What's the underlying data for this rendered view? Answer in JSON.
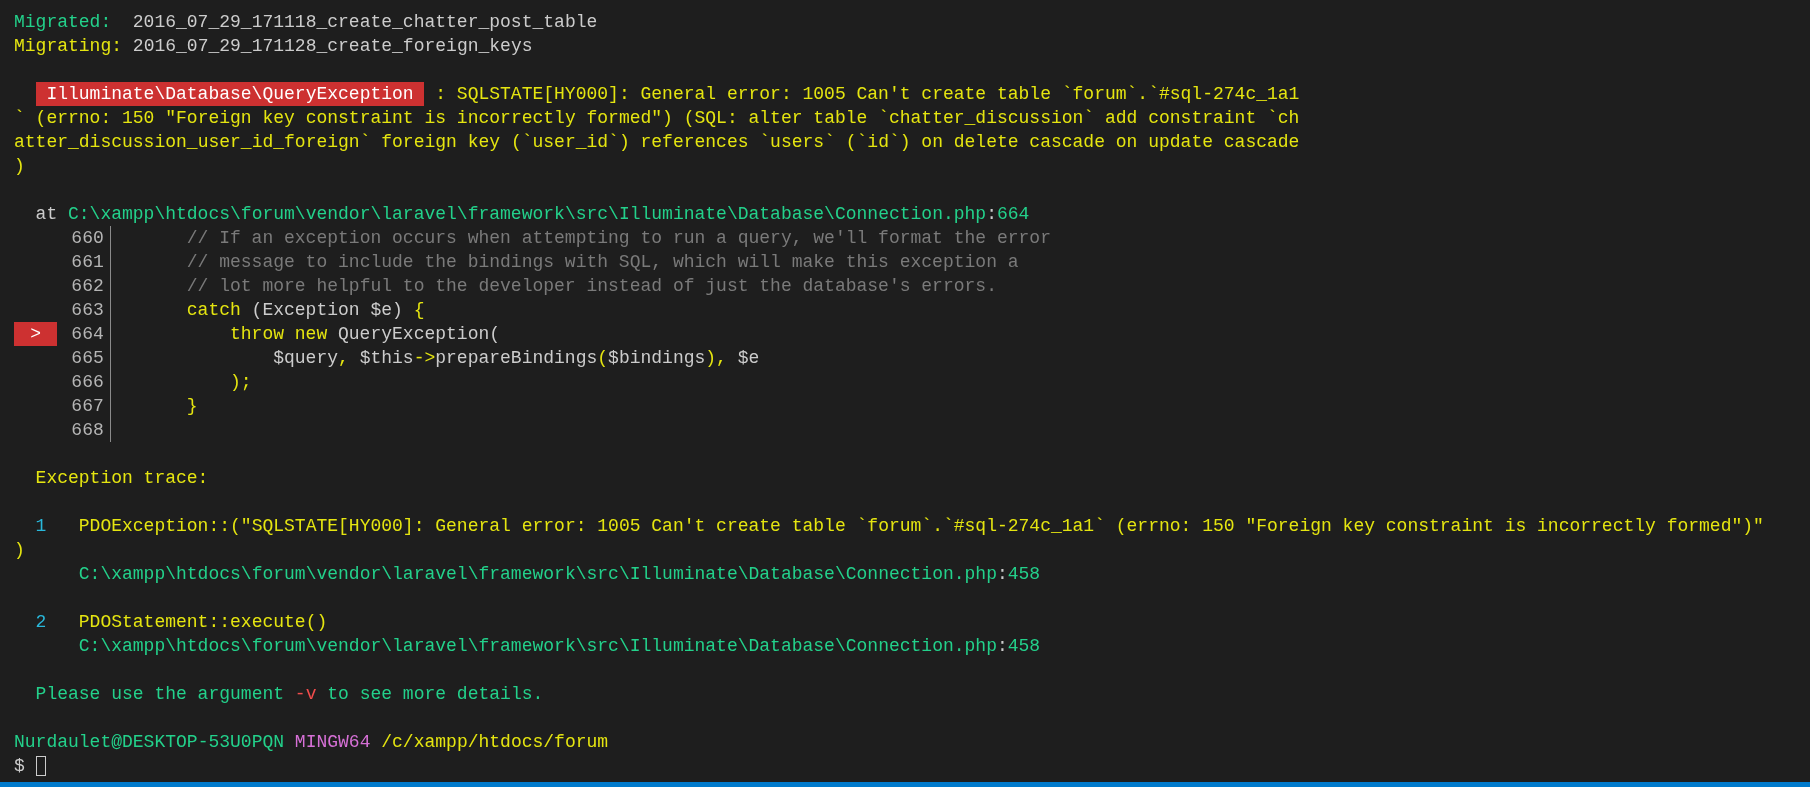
{
  "lines": [
    {
      "kind": "text",
      "segments": [
        {
          "kind": "ok",
          "text": "Migrated:"
        },
        {
          "kind": "plain",
          "text": "  2016_07_29_171118_create_chatter_post_table"
        }
      ]
    },
    {
      "kind": "text",
      "segments": [
        {
          "kind": "warn",
          "text": "Migrating:"
        },
        {
          "kind": "plain",
          "text": " 2016_07_29_171128_create_foreign_keys"
        }
      ]
    },
    {
      "kind": "blank"
    },
    {
      "kind": "text",
      "segments": [
        {
          "kind": "badge",
          "text": "  Illuminate\\Database\\QueryException"
        },
        {
          "kind": "message",
          "text": " : SQLSTATE[HY000]: General error: 1005 Can't create table `forum`.`#sql-274c_1a1"
        }
      ]
    },
    {
      "kind": "text",
      "segments": [
        {
          "kind": "message",
          "text": "` (errno: 150 \"Foreign key constraint is incorrectly formed\") (SQL: alter table `chatter_discussion` add constraint `ch"
        }
      ]
    },
    {
      "kind": "text",
      "segments": [
        {
          "kind": "message",
          "text": "atter_discussion_user_id_foreign` foreign key (`user_id`) references `users` (`id`) on delete cascade on update cascade"
        }
      ]
    },
    {
      "kind": "text",
      "segments": [
        {
          "kind": "message",
          "text": ")"
        }
      ]
    },
    {
      "kind": "blank"
    },
    {
      "kind": "text",
      "segments": [
        {
          "kind": "plain",
          "text": "  at"
        },
        {
          "kind": "path",
          "text": " C:\\xampp\\htdocs\\forum\\vendor\\laravel\\framework\\src\\Illuminate\\Database\\Connection.php"
        },
        {
          "kind": "plain",
          "text": ":"
        },
        {
          "kind": "path",
          "text": "664"
        }
      ]
    },
    {
      "kind": "code",
      "number": "660",
      "selected": false,
      "segments": [
        {
          "kind": "comment",
          "text": "    // If an exception occurs when attempting to run a query, we'll format the error"
        }
      ]
    },
    {
      "kind": "code",
      "number": "661",
      "selected": false,
      "segments": [
        {
          "kind": "comment",
          "text": "    // message to include the bindings with SQL, which will make this exception a"
        }
      ]
    },
    {
      "kind": "code",
      "number": "662",
      "selected": false,
      "segments": [
        {
          "kind": "comment",
          "text": "    // lot more helpful to the developer instead of just the database's errors."
        }
      ]
    },
    {
      "kind": "code",
      "number": "663",
      "selected": false,
      "segments": [
        {
          "kind": "keyword",
          "text": "    catch"
        },
        {
          "kind": "plain",
          "text": " (Exception $e)"
        },
        {
          "kind": "keyword",
          "text": " {"
        }
      ]
    },
    {
      "kind": "code",
      "number": "664",
      "selected": true,
      "marker": ">",
      "segments": [
        {
          "kind": "keyword",
          "text": "        throw new"
        },
        {
          "kind": "plain",
          "text": " QueryException("
        }
      ]
    },
    {
      "kind": "code",
      "number": "665",
      "selected": false,
      "segments": [
        {
          "kind": "plain",
          "text": "            $query"
        },
        {
          "kind": "keyword",
          "text": ","
        },
        {
          "kind": "plain",
          "text": " $this"
        },
        {
          "kind": "keyword",
          "text": "->"
        },
        {
          "kind": "plain",
          "text": "prepareBindings"
        },
        {
          "kind": "keyword",
          "text": "("
        },
        {
          "kind": "plain",
          "text": "$bindings"
        },
        {
          "kind": "keyword",
          "text": "),"
        },
        {
          "kind": "plain",
          "text": " $e"
        }
      ]
    },
    {
      "kind": "code",
      "number": "666",
      "selected": false,
      "segments": [
        {
          "kind": "keyword",
          "text": "        );"
        }
      ]
    },
    {
      "kind": "code",
      "number": "667",
      "selected": false,
      "segments": [
        {
          "kind": "keyword",
          "text": "    }"
        }
      ]
    },
    {
      "kind": "code",
      "number": "668",
      "selected": false
    },
    {
      "kind": "blank"
    },
    {
      "kind": "text",
      "segments": [
        {
          "kind": "warn",
          "text": "  Exception trace:"
        }
      ]
    },
    {
      "kind": "blank"
    },
    {
      "kind": "text",
      "segments": [
        {
          "kind": "index",
          "text": "  1"
        },
        {
          "kind": "message",
          "text": "   PDOException::(\"SQLSTATE[HY000]: General error: 1005 Can't create table `forum`.`#sql-274c_1a1` (errno: 150 \"Foreign key constraint is incorrectly formed\")\""
        }
      ]
    },
    {
      "kind": "text",
      "segments": [
        {
          "kind": "message",
          "text": ")"
        }
      ]
    },
    {
      "kind": "text",
      "segments": [
        {
          "kind": "path",
          "text": "      C:\\xampp\\htdocs\\forum\\vendor\\laravel\\framework\\src\\Illuminate\\Database\\Connection.php"
        },
        {
          "kind": "plain",
          "text": ":"
        },
        {
          "kind": "path",
          "text": "458"
        }
      ]
    },
    {
      "kind": "blank"
    },
    {
      "kind": "text",
      "segments": [
        {
          "kind": "index",
          "text": "  2"
        },
        {
          "kind": "message",
          "text": "   PDOStatement::execute()"
        }
      ]
    },
    {
      "kind": "text",
      "segments": [
        {
          "kind": "path",
          "text": "      C:\\xampp\\htdocs\\forum\\vendor\\laravel\\framework\\src\\Illuminate\\Database\\Connection.php"
        },
        {
          "kind": "plain",
          "text": ":"
        },
        {
          "kind": "path",
          "text": "458"
        }
      ]
    },
    {
      "kind": "blank"
    },
    {
      "kind": "text",
      "segments": [
        {
          "kind": "ok",
          "text": "  Please use the argument"
        },
        {
          "kind": "option",
          "text": " -v"
        },
        {
          "kind": "ok",
          "text": " to see more details."
        }
      ]
    },
    {
      "kind": "blank"
    },
    {
      "kind": "text",
      "segments": [
        {
          "kind": "user",
          "text": "Nurdaulet@DESKTOP-53U0PQN"
        },
        {
          "kind": "shell",
          "text": " MINGW64"
        },
        {
          "kind": "dir",
          "text": " /c/xampp/htdocs/forum"
        }
      ]
    },
    {
      "kind": "prompt",
      "cursor": true,
      "segments": [
        {
          "kind": "plain",
          "text": "$"
        }
      ]
    }
  ]
}
